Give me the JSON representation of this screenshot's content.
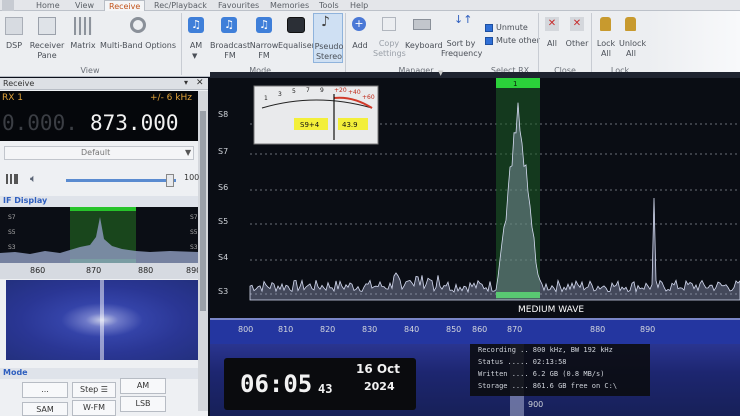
{
  "menu": {
    "tabs": [
      "Home",
      "View",
      "Receive",
      "Rec/Playback",
      "Favourites",
      "Memories",
      "Tools",
      "Help"
    ],
    "active": "Receive"
  },
  "ribbon": {
    "view_group": {
      "title": "View",
      "dsp": "DSP",
      "receiver_pane": "Receiver Pane",
      "matrix": "Matrix",
      "multiband": "Multi-Band Options"
    },
    "mode_group": {
      "title": "Mode...",
      "am": "AM",
      "broadcast": "Broadcast FM",
      "narrow": "Narrow FM",
      "equaliser": "Equaliser",
      "pseudo": "Pseudo Stereo"
    },
    "manager_group": {
      "title": "Manager",
      "add": "Add",
      "copy": "Copy Settings",
      "keyboard": "Keyboard",
      "sort": "Sort by Frequency",
      "unmute": "Unmute",
      "muteother": "Mute other"
    },
    "selectrx_group": {
      "title": "Select RX"
    },
    "close_group": {
      "title": "Close",
      "all": "All",
      "other": "Other"
    },
    "lock_group": {
      "title": "Lock",
      "lockall": "Lock All",
      "unlockall": "Unlock All"
    }
  },
  "left": {
    "receive_title": "Receive",
    "rx_label": "RX 1",
    "bandwidth": "+/- 6 kHz",
    "freq_dim": "0.000.",
    "freq_main": "873.000",
    "profile": "Default",
    "volume": "100",
    "if_title": "IF Display",
    "if_ylabels": [
      "S7",
      "S5",
      "S3"
    ],
    "if_xlabels": [
      "860",
      "870",
      "880",
      "890"
    ],
    "mode_title": "Mode",
    "mode_buttons": [
      "...",
      "Step ☰",
      "AM",
      "SAM",
      "W-FM",
      "LSB"
    ]
  },
  "spectrum": {
    "ylabels": [
      "S8",
      "S7",
      "S6",
      "S5",
      "S4",
      "S3"
    ],
    "xlabels": [
      "800",
      "810",
      "820",
      "830",
      "840",
      "850",
      "860",
      "870",
      "880",
      "890"
    ],
    "band_label": "MEDIUM WAVE",
    "channel_label": "1",
    "meter": {
      "scale": [
        "1",
        "3",
        "5",
        "7",
        "9",
        "+20",
        "+40",
        "+60"
      ],
      "signal": "S9+4",
      "value": "43.9"
    }
  },
  "clock": {
    "time": "06:05",
    "seconds": "43",
    "date": "16 Oct",
    "year": "2024"
  },
  "recording": {
    "line1": "Recording .. 800 kHz, BW 192 kHz",
    "line2": "Status ..... 02:13:58",
    "line3": "Written .... 6.2 GB (0.8 MB/s)",
    "line4": "Storage .... 861.6 GB free on C:\\"
  },
  "bottom_x": "900"
}
